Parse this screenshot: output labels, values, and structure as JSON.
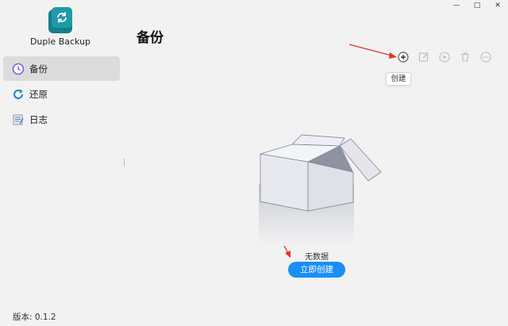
{
  "app": {
    "name": "Duple Backup",
    "version": "版本: 0.1.2"
  },
  "window_controls": {
    "minimize": "—",
    "maximize": "□",
    "close": "✕"
  },
  "sidebar": {
    "items": [
      {
        "label": "备份",
        "icon": "clock-icon",
        "active": true
      },
      {
        "label": "还原",
        "icon": "restore-icon",
        "active": false
      },
      {
        "label": "日志",
        "icon": "log-icon",
        "active": false
      }
    ]
  },
  "main": {
    "title": "备份",
    "toolbar": {
      "buttons": [
        "create-icon",
        "edit-icon",
        "run-icon",
        "delete-icon",
        "more-icon"
      ],
      "tooltip": "创建"
    },
    "empty_state": {
      "text": "无数据",
      "button": "立即创建"
    }
  },
  "colors": {
    "accent": "#1a8ef5",
    "logo": "#1f9aa8",
    "arrow": "#e0332c",
    "active_nav": "#dcdcdc"
  }
}
